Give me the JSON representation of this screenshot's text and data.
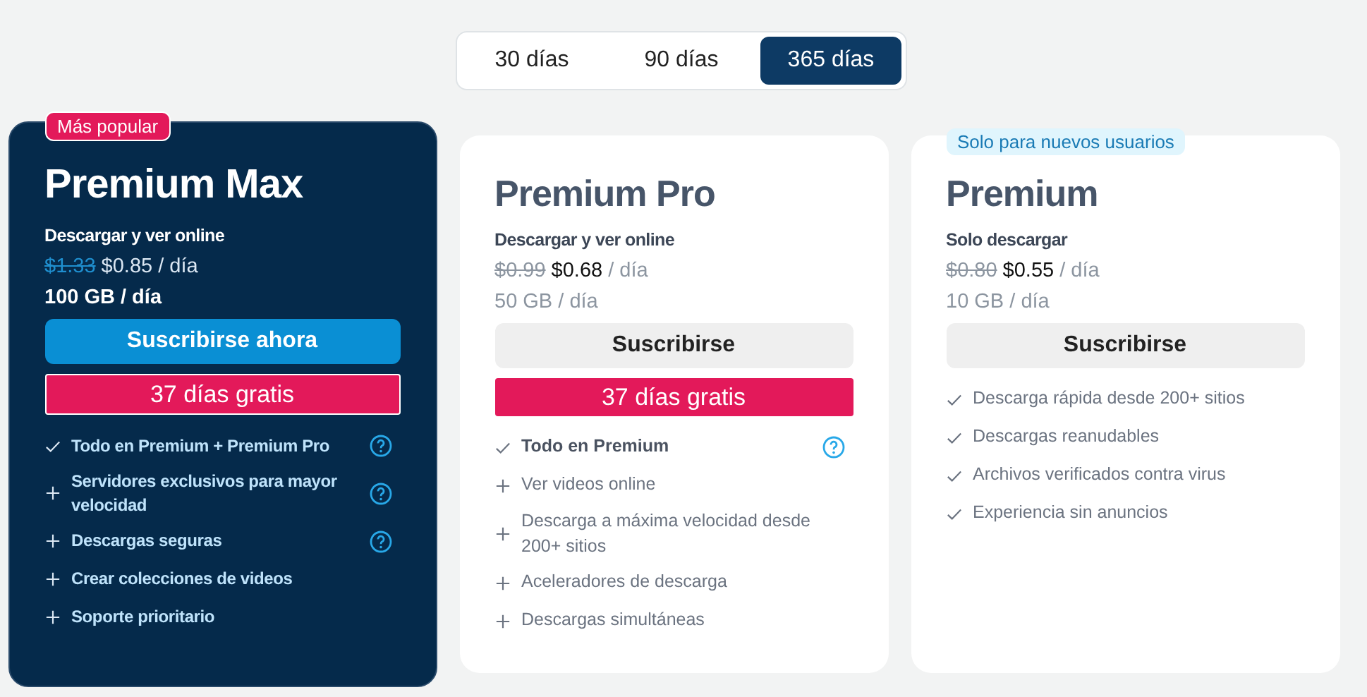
{
  "periods": [
    {
      "label": "30 días",
      "selected": false
    },
    {
      "label": "90 días",
      "selected": false
    },
    {
      "label": "365 días",
      "selected": true
    }
  ],
  "plans": [
    {
      "featured": true,
      "badge": {
        "text": "Más popular",
        "kind": "popular"
      },
      "name": "Premium Max",
      "subtitle": "Descargar y ver online",
      "old_price": "$1.33",
      "price": "$0.85",
      "per": "/ día",
      "quota": "100 GB / día",
      "button": "Suscribirse ahora",
      "trial": "37 días gratis",
      "features": [
        {
          "kind": "included",
          "text": "Todo en Premium + Premium Pro",
          "bold": true,
          "help": true
        },
        {
          "kind": "extra",
          "text": "Servidores exclusivos para mayor velocidad",
          "bold": true,
          "help": true
        },
        {
          "kind": "extra",
          "text": "Descargas seguras",
          "bold": true,
          "help": true
        },
        {
          "kind": "extra",
          "text": "Crear colecciones de videos",
          "bold": true,
          "help": false
        },
        {
          "kind": "extra",
          "text": "Soporte prioritario",
          "bold": true,
          "help": false
        }
      ]
    },
    {
      "featured": false,
      "name": "Premium Pro",
      "subtitle": "Descargar y ver online",
      "old_price": "$0.99",
      "price": "$0.68",
      "per": "/ día",
      "quota": "50 GB / día",
      "button": "Suscribirse",
      "trial": "37 días gratis",
      "features": [
        {
          "kind": "included",
          "text": "Todo en Premium",
          "bold": true,
          "help": true
        },
        {
          "kind": "extra",
          "text": "Ver videos online",
          "bold": false,
          "help": false
        },
        {
          "kind": "extra",
          "text": "Descarga a máxima velocidad desde 200+ sitios",
          "bold": false,
          "help": false
        },
        {
          "kind": "extra",
          "text": "Aceleradores de descarga",
          "bold": false,
          "help": false
        },
        {
          "kind": "extra",
          "text": "Descargas simultáneas",
          "bold": false,
          "help": false
        }
      ]
    },
    {
      "featured": false,
      "badge": {
        "text": "Solo para nuevos usuarios",
        "kind": "new"
      },
      "name": "Premium",
      "subtitle": "Solo descargar",
      "old_price": "$0.80",
      "price": "$0.55",
      "per": "/ día",
      "quota": "10 GB / día",
      "button": "Suscribirse",
      "features": [
        {
          "kind": "included",
          "text": "Descarga rápida desde 200+ sitios",
          "bold": false,
          "help": false
        },
        {
          "kind": "included",
          "text": "Descargas reanudables",
          "bold": false,
          "help": false
        },
        {
          "kind": "included",
          "text": "Archivos verificados contra virus",
          "bold": false,
          "help": false
        },
        {
          "kind": "included",
          "text": "Experiencia sin anuncios",
          "bold": false,
          "help": false
        }
      ]
    }
  ]
}
